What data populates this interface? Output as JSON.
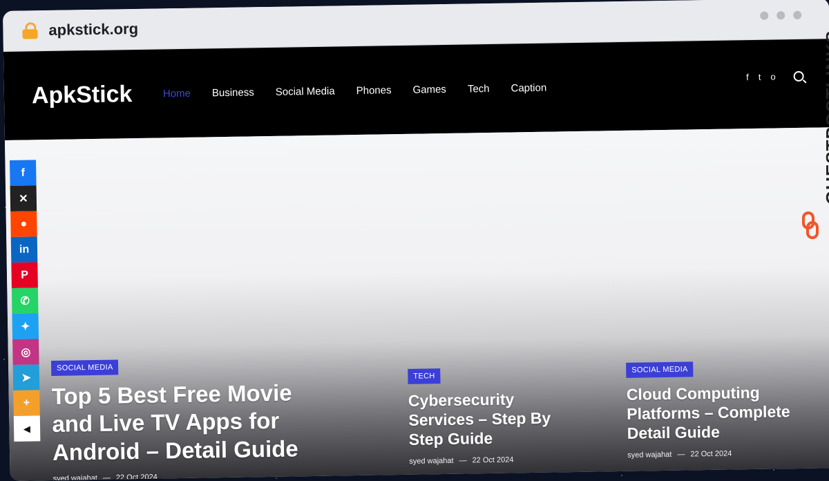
{
  "browser": {
    "url": "apkstick.org"
  },
  "header": {
    "logo": "ApkStick",
    "nav": [
      "Home",
      "Business",
      "Social Media",
      "Phones",
      "Games",
      "Tech",
      "Caption"
    ],
    "social": [
      "f",
      "t",
      "o"
    ]
  },
  "share_bar": [
    "facebook",
    "x",
    "reddit",
    "linkedin",
    "pinterest",
    "whatsapp",
    "twitter",
    "instagram",
    "telegram",
    "more",
    "hide"
  ],
  "posts": [
    {
      "category": "SOCIAL MEDIA",
      "title": "Top 5 Best Free Movie and Live TV Apps for Android – Detail Guide",
      "author": "syed wajahat",
      "sep": "—",
      "date": "22 Oct 2024"
    },
    {
      "category": "TECH",
      "title": "Cybersecurity Services – Step By Step Guide",
      "author": "syed wajahat",
      "sep": "—",
      "date": "22 Oct 2024"
    },
    {
      "category": "SOCIAL MEDIA",
      "title": "Cloud Computing Platforms – Complete Detail Guide",
      "author": "syed wajahat",
      "sep": "—",
      "date": "22 Oct 2024"
    }
  ],
  "watermark": "GUESTPOSTLINKS",
  "colors": {
    "accent": "#3b3fd6",
    "header_bg": "#000000"
  }
}
